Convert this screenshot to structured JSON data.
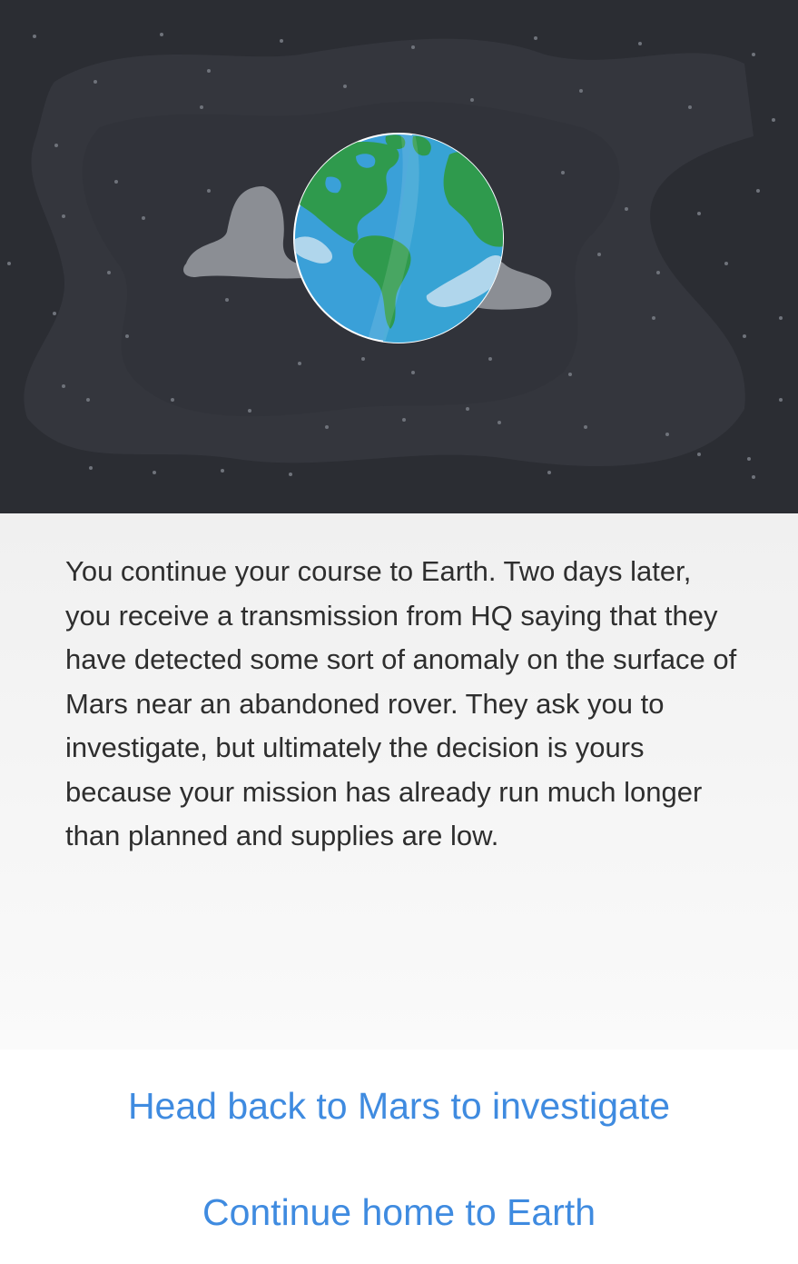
{
  "scene": {
    "image_icon": "earth-in-space-illustration",
    "colors": {
      "space": "#2b2d33",
      "ocean": "#3a9fd6",
      "land": "#2f9a4d",
      "clouds": "#8b8e94"
    }
  },
  "story": {
    "text": "You continue your course to Earth. Two days later, you receive a transmission from HQ saying that they have detected some sort of anomaly on the surface of Mars near an abandoned rover. They ask you to investigate, but ultimately the decision is yours because your mission has already run much longer than planned and supplies are low."
  },
  "choices": [
    {
      "label": "Head back to Mars to investigate"
    },
    {
      "label": "Continue home to Earth"
    }
  ],
  "colors": {
    "link": "#3f8be0",
    "text": "#2e2e2e"
  }
}
